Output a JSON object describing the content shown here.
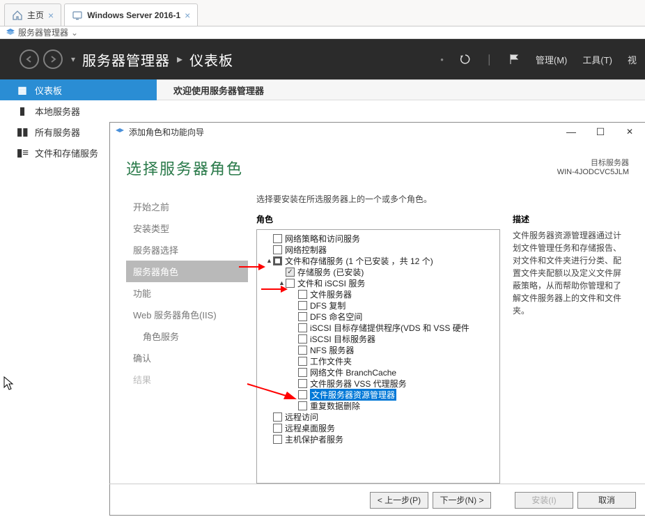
{
  "tabs": [
    {
      "label": "主页",
      "icon": "home"
    },
    {
      "label": "Windows Server 2016-1",
      "icon": "server",
      "active": true
    }
  ],
  "crumb": {
    "icon_name": "layers-icon",
    "text": "服务器管理器"
  },
  "header": {
    "breadcrumb": [
      "服务器管理器",
      "仪表板"
    ],
    "sep": "▸",
    "menu": {
      "manage": "管理(M)",
      "tools": "工具(T)",
      "view": "视"
    }
  },
  "leftnav": [
    {
      "glyph": "▦",
      "label": "仪表板",
      "active": true
    },
    {
      "glyph": "▮",
      "label": "本地服务器"
    },
    {
      "glyph": "▮▮",
      "label": "所有服务器"
    },
    {
      "glyph": "▮≡",
      "label": "文件和存储服务",
      "flyout": "▸"
    }
  ],
  "welcome": "欢迎使用服务器管理器",
  "wizard": {
    "title": "添加角色和功能向导",
    "heading": "选择服务器角色",
    "target": {
      "label": "目标服务器",
      "server": "WIN-4JODCVC5JLM"
    },
    "instr": "选择要安装在所选服务器上的一个或多个角色。",
    "roles_header": "角色",
    "desc_header": "描述",
    "desc_text": "文件服务器资源管理器通过计划文件管理任务和存储报告、对文件和文件夹进行分类、配置文件夹配额以及定义文件屏蔽策略，从而帮助你管理和了解文件服务器上的文件和文件夹。",
    "steps": [
      {
        "label": "开始之前"
      },
      {
        "label": "安装类型"
      },
      {
        "label": "服务器选择"
      },
      {
        "label": "服务器角色",
        "selected": true
      },
      {
        "label": "功能"
      },
      {
        "label": "Web 服务器角色(IIS)"
      },
      {
        "label": "角色服务",
        "indent": true
      },
      {
        "label": "确认"
      },
      {
        "label": "结果",
        "disabled": true
      }
    ],
    "roles": [
      {
        "depth": 0,
        "cb": "blank",
        "label": "网络策略和访问服务"
      },
      {
        "depth": 0,
        "cb": "blank",
        "label": "网络控制器"
      },
      {
        "depth": 0,
        "cb": "mixed",
        "exp": "▲",
        "label": "文件和存储服务 (1 个已安装 ，共 12 个)"
      },
      {
        "depth": 1,
        "cb": "checked",
        "disabled": true,
        "label": "存储服务 (已安装)"
      },
      {
        "depth": 1,
        "cb": "blank",
        "exp": "▲",
        "label": "文件和 iSCSI 服务"
      },
      {
        "depth": 2,
        "cb": "blank",
        "label": "文件服务器"
      },
      {
        "depth": 2,
        "cb": "blank",
        "label": "DFS 复制"
      },
      {
        "depth": 2,
        "cb": "blank",
        "label": "DFS 命名空间"
      },
      {
        "depth": 2,
        "cb": "blank",
        "label": "iSCSI 目标存储提供程序(VDS 和 VSS 硬件"
      },
      {
        "depth": 2,
        "cb": "blank",
        "label": "iSCSI 目标服务器"
      },
      {
        "depth": 2,
        "cb": "blank",
        "label": "NFS 服务器"
      },
      {
        "depth": 2,
        "cb": "blank",
        "label": "工作文件夹"
      },
      {
        "depth": 2,
        "cb": "blank",
        "label": "网络文件 BranchCache"
      },
      {
        "depth": 2,
        "cb": "blank",
        "label": "文件服务器 VSS 代理服务"
      },
      {
        "depth": 2,
        "cb": "blank",
        "label": "文件服务器资源管理器",
        "selected": true
      },
      {
        "depth": 2,
        "cb": "blank",
        "label": "重复数据删除"
      },
      {
        "depth": 0,
        "cb": "blank",
        "label": "远程访问"
      },
      {
        "depth": 0,
        "cb": "blank",
        "label": "远程桌面服务"
      },
      {
        "depth": 0,
        "cb": "blank",
        "label": "主机保护者服务"
      }
    ],
    "buttons": {
      "prev": "< 上一步(P)",
      "next": "下一步(N) >",
      "install": "安装(I)",
      "cancel": "取消"
    }
  }
}
